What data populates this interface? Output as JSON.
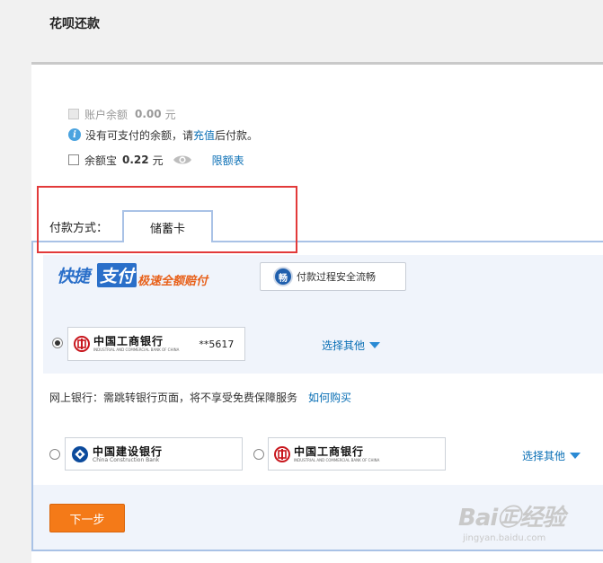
{
  "header": {
    "title": "花呗还款"
  },
  "balance": {
    "label": "账户余额",
    "amount": "0.00",
    "unit": "元",
    "notice_prefix": "没有可支付的余额，请",
    "notice_link": "充值",
    "notice_suffix": "后付款。"
  },
  "yuebao": {
    "label": "余额宝",
    "amount": "0.22",
    "unit": "元",
    "limit_link": "限额表"
  },
  "payment": {
    "label": "付款方式：",
    "active_tab": "储蓄卡"
  },
  "quick_pay": {
    "logo_part1": "快捷",
    "logo_part2": "支付",
    "slogan": "极速全额赔付",
    "safety_icon_char": "畅",
    "safety_text": "付款过程安全流畅",
    "saved_card": {
      "bank_name": "中国工商银行",
      "bank_name_en": "INDUSTRIAL AND COMMERCIAL BANK OF CHINA",
      "card_mask": "**5617",
      "selected": true
    },
    "choose_other": "选择其他"
  },
  "online_bank": {
    "notice": "网上银行：需跳转银行页面，将不享受免费保障服务",
    "how_link": "如何购买",
    "banks": [
      {
        "name": "中国建设银行",
        "name_en": "China Construction Bank",
        "color": "#0b4a9c"
      },
      {
        "name": "中国工商银行",
        "name_en": "INDUSTRIAL AND COMMERCIAL BANK OF CHINA",
        "color": "#c8161d"
      }
    ],
    "choose_other": "选择其他"
  },
  "actions": {
    "next": "下一步"
  },
  "watermark": {
    "main": "Bai㊣经验",
    "sub": "jingyan.baidu.com"
  },
  "colors": {
    "accent_orange": "#f47a18",
    "link_blue": "#0a6fb5",
    "highlight_red": "#e23a3a",
    "border_blue": "#a9c2e6"
  }
}
